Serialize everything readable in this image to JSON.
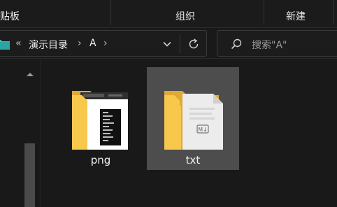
{
  "ribbon": {
    "groups": [
      "贴板",
      "组织",
      "新建"
    ]
  },
  "address": {
    "overflow_chevron": "«",
    "crumbs": [
      "演示目录",
      "A"
    ],
    "separator": "›"
  },
  "search": {
    "placeholder": "搜索\"A\""
  },
  "items": [
    {
      "label": "png",
      "type": "folder-with-screenshot-preview",
      "selected": false
    },
    {
      "label": "txt",
      "type": "folder-with-markdown-document",
      "selected": true
    }
  ],
  "preview_doc_badge": "M↓",
  "colors": {
    "folder_front": "#f7c84c",
    "folder_back": "#e0a934",
    "selection": "#4d4d4d",
    "address_folder_icon": "#35c2c0",
    "background": "#191919"
  }
}
